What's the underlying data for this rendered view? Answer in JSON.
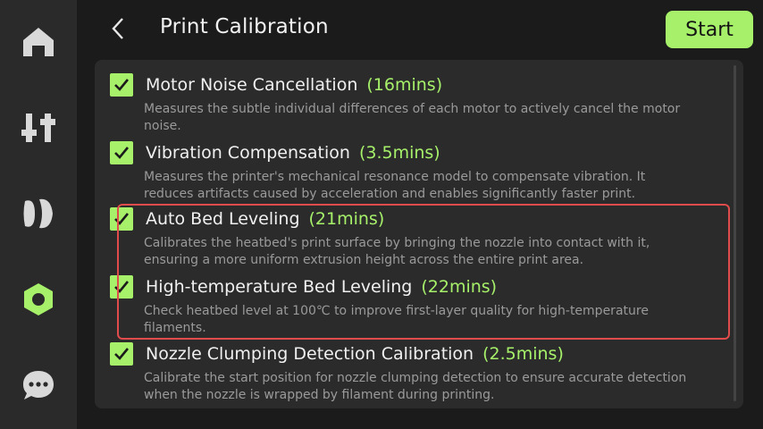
{
  "sidebar": {
    "items": [
      {
        "icon": "home-icon"
      },
      {
        "icon": "controls-icon"
      },
      {
        "icon": "filament-icon"
      },
      {
        "icon": "settings-icon",
        "active": true
      },
      {
        "icon": "chat-icon"
      }
    ]
  },
  "header": {
    "title": "Print Calibration",
    "start_label": "Start"
  },
  "calibrations": [
    {
      "name": "Motor Noise Cancellation",
      "time": "(16mins)",
      "description": "Measures the subtle individual differences of each motor to actively cancel the motor noise."
    },
    {
      "name": "Vibration Compensation",
      "time": "(3.5mins)",
      "description": "Measures the printer's mechanical resonance model to compensate vibration. It reduces artifacts caused by acceleration and enables significantly faster print."
    },
    {
      "name": "Auto Bed Leveling",
      "time": "(21mins)",
      "description": "Calibrates the heatbed's print surface by bringing the nozzle into contact with it, ensuring a more uniform extrusion height across the entire print area."
    },
    {
      "name": "High-temperature Bed Leveling",
      "time": "(22mins)",
      "description": "Check heatbed level at 100℃ to improve first-layer quality for high-temperature filaments."
    },
    {
      "name": "Nozzle Clumping Detection Calibration",
      "time": "(2.5mins)",
      "description": "Calibrate the start position for nozzle clumping detection to ensure accurate detection when the nozzle is wrapped by filament during printing."
    }
  ],
  "colors": {
    "accent": "#a6f06a",
    "highlight_border": "#e04b4b",
    "panel": "#2b2b2b",
    "sidebar": "#2a2a2a",
    "background": "#1b1b1b"
  }
}
